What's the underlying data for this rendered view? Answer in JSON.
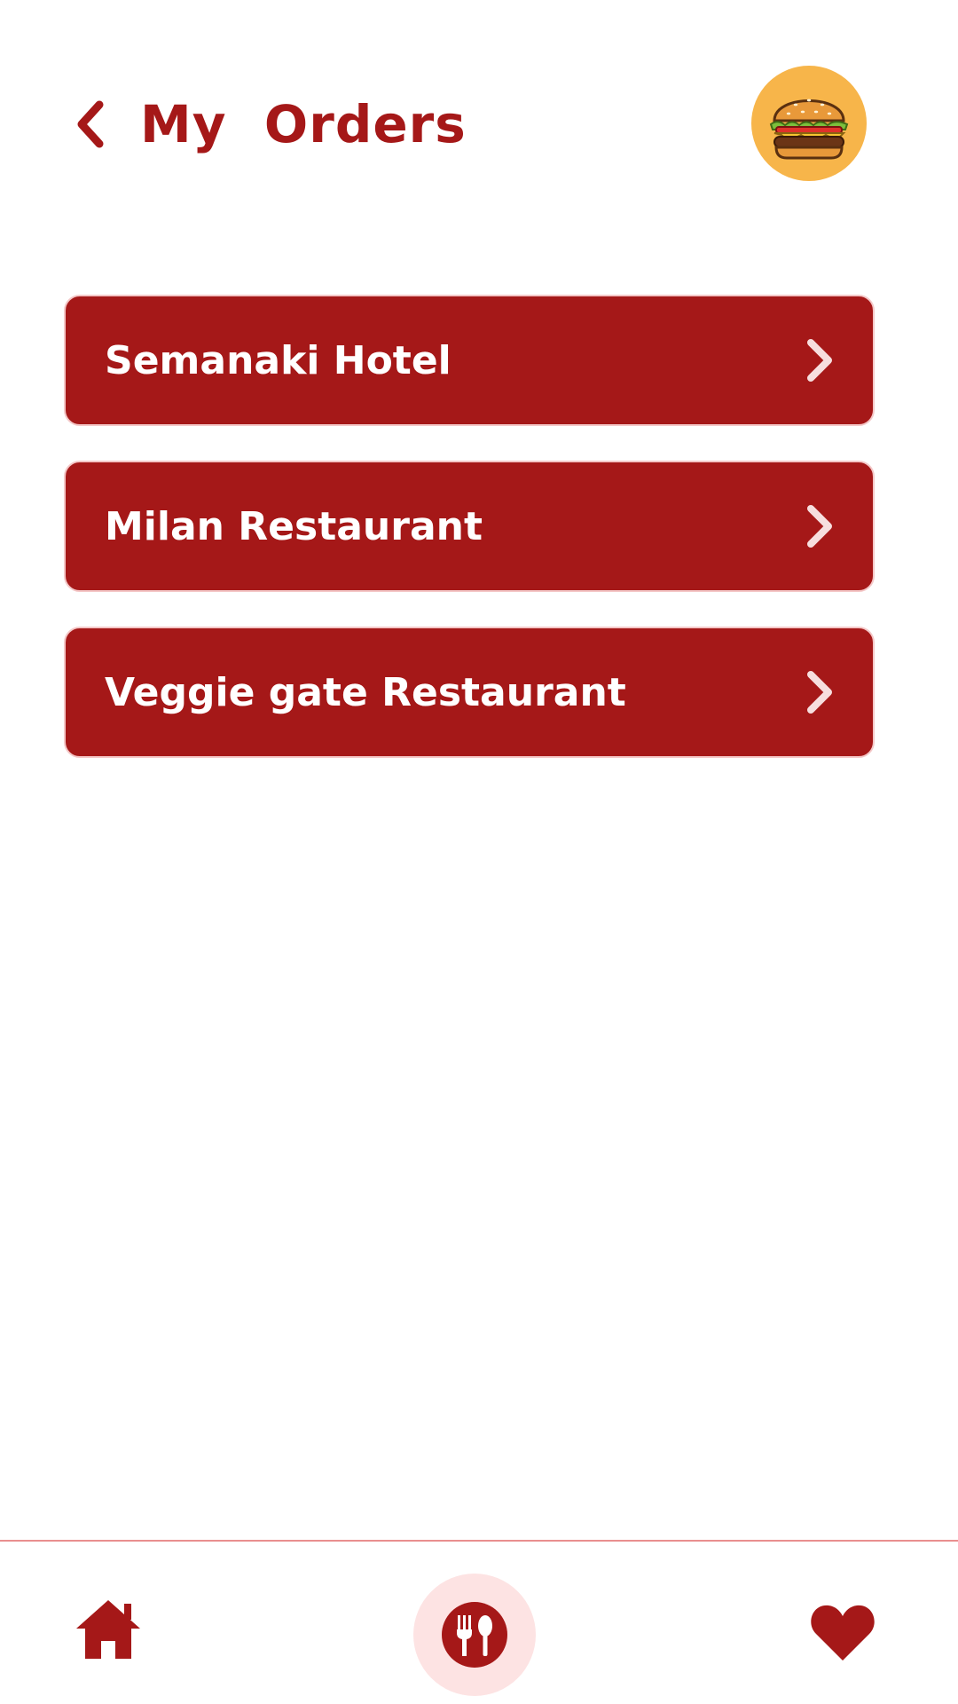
{
  "header": {
    "title": "My  Orders",
    "back_icon": "chevron-left-icon",
    "avatar_icon": "burger-icon"
  },
  "orders": [
    {
      "name": "Semanaki Hotel"
    },
    {
      "name": "Milan Restaurant"
    },
    {
      "name": "Veggie gate Restaurant"
    }
  ],
  "bottom_nav": {
    "items": [
      {
        "icon": "home-icon",
        "active": false
      },
      {
        "icon": "fork-spoon-icon",
        "active": true
      },
      {
        "icon": "heart-icon",
        "active": false
      }
    ]
  },
  "colors": {
    "primary": "#a51818",
    "card_border": "#f4c7c7",
    "chevron": "#f7dede",
    "avatar_bg": "#f7b54a",
    "active_nav_bg": "#fde3e3",
    "divider": "#e98f8f"
  }
}
